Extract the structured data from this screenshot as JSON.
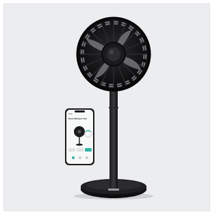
{
  "phone": {
    "time": "9:41",
    "screen_title": "Duux Whisper Flex"
  }
}
